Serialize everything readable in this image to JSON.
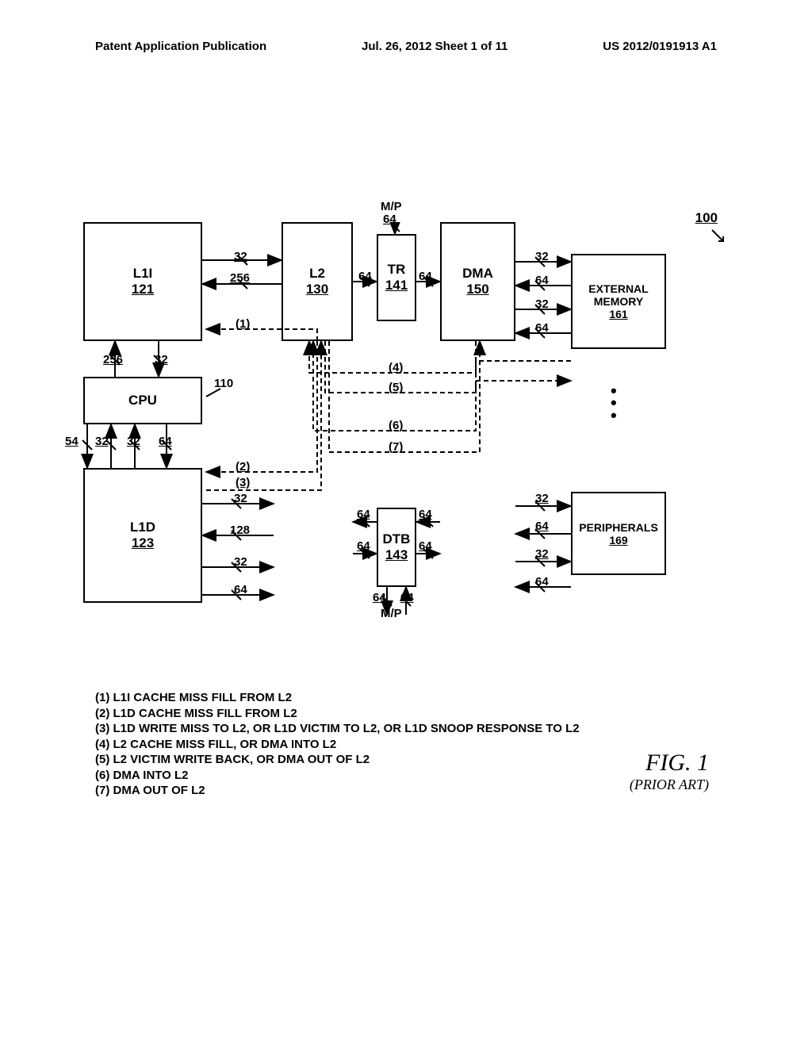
{
  "header": {
    "left": "Patent Application Publication",
    "center": "Jul. 26, 2012  Sheet 1 of 11",
    "right": "US 2012/0191913 A1"
  },
  "ref100": "100",
  "blocks": {
    "l1i": {
      "name": "L1I",
      "id": "121"
    },
    "cpu": {
      "name": "CPU",
      "id": ""
    },
    "l1d": {
      "name": "L1D",
      "id": "123"
    },
    "l2": {
      "name": "L2",
      "id": "130"
    },
    "tr": {
      "name": "TR",
      "id": "141"
    },
    "dtb": {
      "name": "DTB",
      "id": "143"
    },
    "dma": {
      "name": "DMA",
      "id": "150"
    },
    "extm": {
      "name": "EXTERNAL MEMORY",
      "id": "161"
    },
    "peri": {
      "name": "PERIPHERALS",
      "id": "169"
    }
  },
  "cpu_ref": "110",
  "mp_top": "M/P",
  "mp_bot": "M/P",
  "buswidths": {
    "w32": "32",
    "w64": "64",
    "w128": "128",
    "w256": "256"
  },
  "paths": {
    "p1": "(1)",
    "p2": "(2)",
    "p3": "(3)",
    "p4": "(4)",
    "p5": "(5)",
    "p6": "(6)",
    "p7": "(7)"
  },
  "legend": {
    "l1": "(1) L1I CACHE MISS FILL FROM L2",
    "l2": "(2) L1D CACHE MISS FILL FROM L2",
    "l3": "(3) L1D WRITE MISS TO L2, OR L1D VICTIM TO L2, OR L1D SNOOP RESPONSE TO L2",
    "l4": "(4) L2 CACHE MISS FILL, OR DMA INTO L2",
    "l5": "(5) L2 VICTIM WRITE BACK, OR DMA OUT OF L2",
    "l6": "(6) DMA INTO L2",
    "l7": "(7) DMA OUT OF L2"
  },
  "fig": {
    "label": "FIG.  1",
    "sub": "(PRIOR  ART)"
  }
}
